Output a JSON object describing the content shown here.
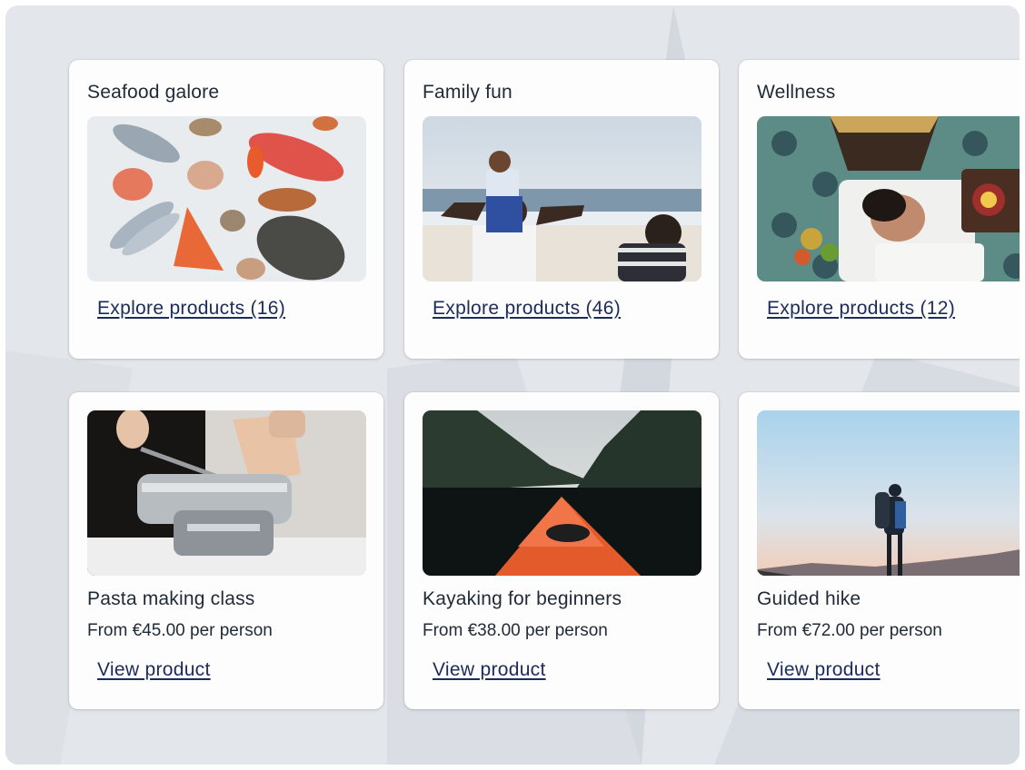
{
  "categories": [
    {
      "title": "Seafood galore",
      "image_alt": "Assorted fresh seafood on ice",
      "link": "Explore products (16)"
    },
    {
      "title": "Family fun",
      "image_alt": "Family playing on a beach",
      "link": "Explore products (46)"
    },
    {
      "title": "Wellness",
      "image_alt": "Woman receiving a head massage",
      "link": "Explore products (12)"
    }
  ],
  "products": [
    {
      "title": "Pasta making class",
      "image_alt": "Hands using a pasta machine",
      "price": "From €45.00 per person",
      "link": "View product"
    },
    {
      "title": "Kayaking for beginners",
      "image_alt": "Kayak bow on a fjord",
      "price": "From €38.00 per person",
      "link": "View product"
    },
    {
      "title": "Guided hike",
      "image_alt": "Hiker silhouetted at sunrise",
      "price": "From €72.00 per person",
      "link": "View product"
    }
  ],
  "colors": {
    "background": "#e3e6ea",
    "card": "#fdfdfd",
    "link": "#1c2c5a",
    "text": "#1f2a37"
  }
}
